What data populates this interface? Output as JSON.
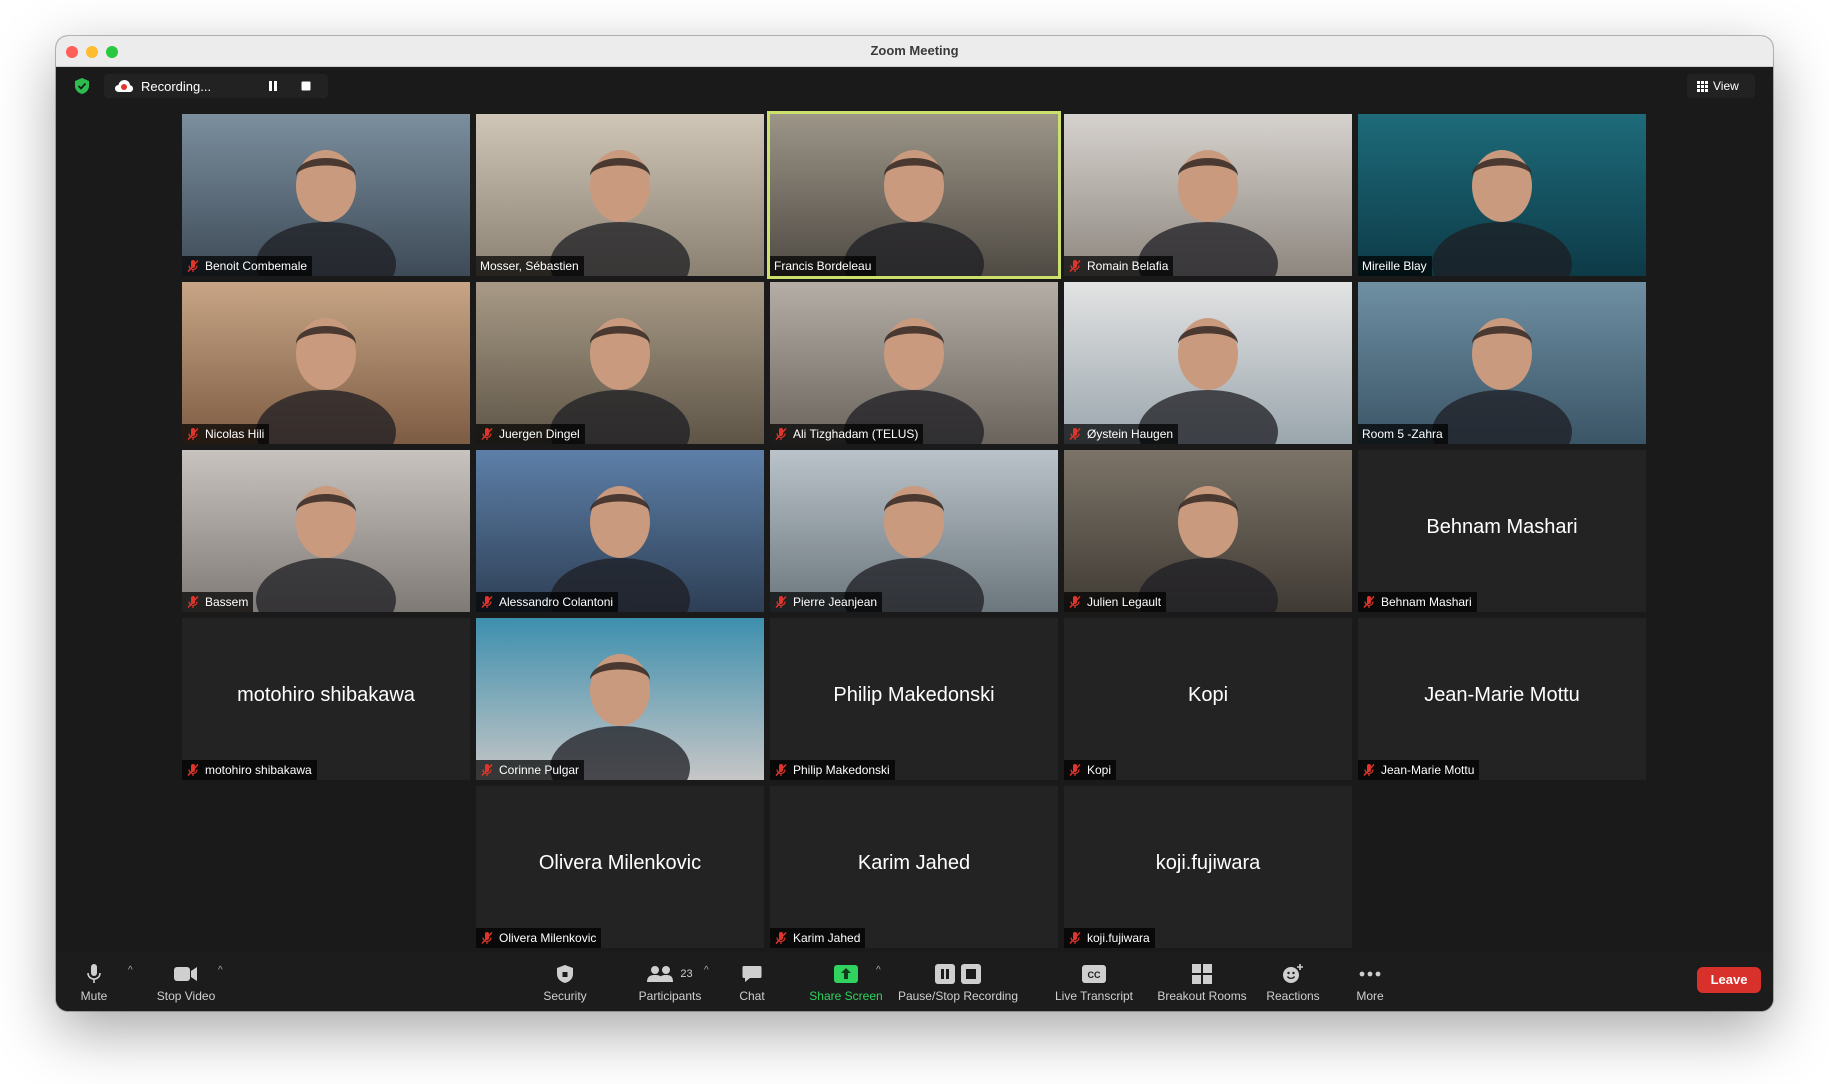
{
  "window": {
    "title": "Zoom Meeting"
  },
  "topbar": {
    "recording_label": "Recording...",
    "view_label": "View",
    "icons": [
      "shield-check-icon",
      "cloud-record-icon",
      "pause-icon",
      "stop-icon",
      "grid-icon"
    ]
  },
  "colors": {
    "active_speaker_border": "#cbe16b",
    "leave_button": "#d8302b",
    "share_screen": "#2fd35d",
    "shield": "#2dbd4e"
  },
  "participants": [
    {
      "name": "Benoit Combemale",
      "video": true,
      "muted": true
    },
    {
      "name": "Mosser, Sébastien",
      "video": true,
      "muted": false
    },
    {
      "name": "Francis Bordeleau",
      "video": true,
      "muted": false,
      "active_speaker": true
    },
    {
      "name": "Romain Belafia",
      "video": true,
      "muted": true
    },
    {
      "name": "Mireille Blay",
      "video": true,
      "muted": false
    },
    {
      "name": "Nicolas Hili",
      "video": true,
      "muted": true
    },
    {
      "name": "Juergen Dingel",
      "video": true,
      "muted": true
    },
    {
      "name": "Ali Tizghadam (TELUS)",
      "video": true,
      "muted": true
    },
    {
      "name": "Øystein Haugen",
      "video": true,
      "muted": true
    },
    {
      "name": "Room 5 -Zahra",
      "video": true,
      "muted": false
    },
    {
      "name": "Bassem",
      "video": true,
      "muted": true
    },
    {
      "name": "Alessandro Colantoni",
      "video": true,
      "muted": true
    },
    {
      "name": "Pierre Jeanjean",
      "video": true,
      "muted": true
    },
    {
      "name": "Julien Legault",
      "video": true,
      "muted": true
    },
    {
      "name": "Behnam Mashari",
      "video": false,
      "muted": true
    },
    {
      "name": "motohiro shibakawa",
      "video": false,
      "muted": true
    },
    {
      "name": "Corinne Pulgar",
      "video": true,
      "muted": true
    },
    {
      "name": "Philip Makedonski",
      "video": false,
      "muted": true
    },
    {
      "name": "Kopi",
      "video": false,
      "muted": true
    },
    {
      "name": "Jean-Marie Mottu",
      "video": false,
      "muted": true
    },
    {
      "name": "Olivera Milenkovic",
      "video": false,
      "muted": true
    },
    {
      "name": "Karim Jahed",
      "video": false,
      "muted": true
    },
    {
      "name": "koji.fujiwara",
      "video": false,
      "muted": true
    }
  ],
  "toolbar": {
    "mute": "Mute",
    "stop_video": "Stop Video",
    "security": "Security",
    "participants": "Participants",
    "participants_count": "23",
    "chat": "Chat",
    "share_screen": "Share Screen",
    "pause_stop_recording": "Pause/Stop Recording",
    "live_transcript": "Live Transcript",
    "breakout_rooms": "Breakout Rooms",
    "reactions": "Reactions",
    "more": "More",
    "leave": "Leave"
  }
}
